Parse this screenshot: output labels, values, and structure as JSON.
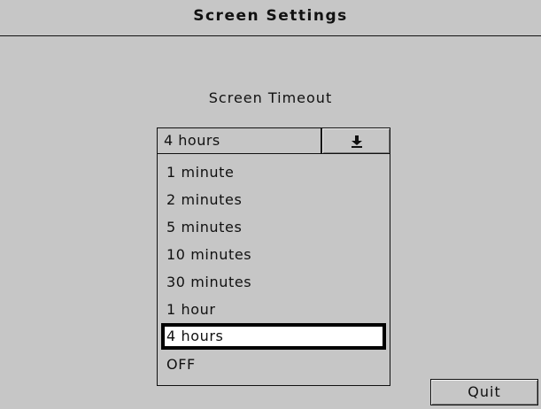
{
  "window": {
    "title": "Screen Settings"
  },
  "screen_timeout": {
    "label": "Screen Timeout",
    "selected_value": "4 hours",
    "options": [
      "1 minute",
      "2 minutes",
      "5 minutes",
      "10 minutes",
      "30 minutes",
      "1 hour",
      "4 hours",
      "OFF"
    ],
    "highlighted_option": "4 hours"
  },
  "buttons": {
    "quit_label": "Quit"
  },
  "icons": {
    "dropdown": "arrow-down-to-line-icon"
  },
  "colors": {
    "background": "#c6c6c6",
    "highlight_background": "#ffffff",
    "outline": "#000000"
  }
}
